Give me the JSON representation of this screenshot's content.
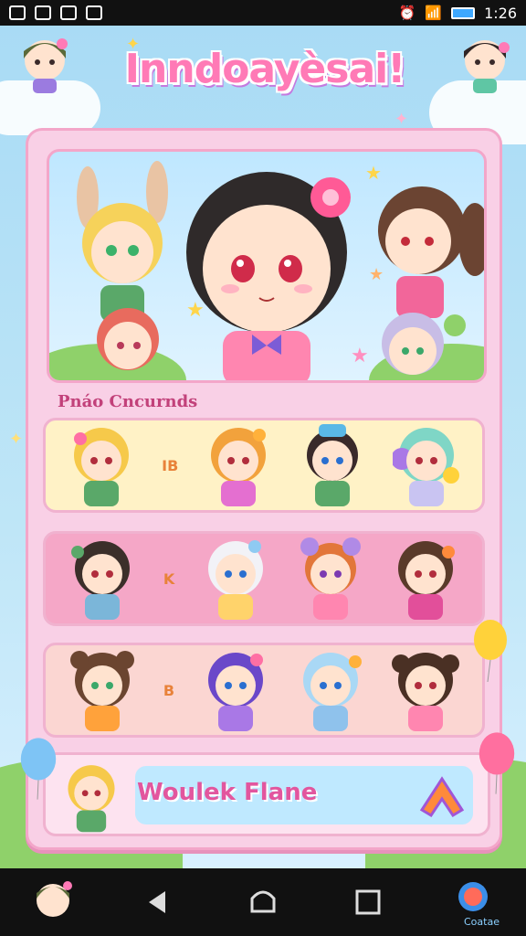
{
  "status_bar": {
    "time": "1:26"
  },
  "app": {
    "title": "Inndoayèsai!"
  },
  "section": {
    "title": "Pnáo Cncurnds"
  },
  "bottom_card": {
    "label": "Woulek Flane",
    "action_icon": "arrow-up-icon"
  },
  "nav": {
    "app_label": "Coatae"
  },
  "colors": {
    "accent": "#ff7ab6",
    "panel": "#f9d0e6",
    "row1": "#fff2c6",
    "row2": "#f5a7c7",
    "row3": "#fbd6d2"
  },
  "rows": [
    {
      "separator": "IB",
      "characters": [
        {
          "name": "blonde-girl",
          "hair": "#f6c94a"
        },
        {
          "name": "orange-hair-girl",
          "hair": "#f2a23c"
        },
        {
          "name": "hat-boy",
          "hair": "#3a2a2a"
        },
        {
          "name": "teal-hair-girl",
          "hair": "#7fd6c6"
        }
      ]
    },
    {
      "separator": "K",
      "characters": [
        {
          "name": "dark-hair-boy",
          "hair": "#3b2f2a"
        },
        {
          "name": "white-hair-girl",
          "hair": "#f2f2f7"
        },
        {
          "name": "orange-hair-girl",
          "hair": "#e2763a"
        },
        {
          "name": "brown-hair-girl",
          "hair": "#5a3a2a"
        }
      ]
    },
    {
      "separator": "B",
      "characters": [
        {
          "name": "brown-bun-girl",
          "hair": "#6b4530"
        },
        {
          "name": "purple-hair-girl",
          "hair": "#6a48c9"
        },
        {
          "name": "light-blue-hair-boy",
          "hair": "#a9d8f5"
        },
        {
          "name": "dark-bun-girl",
          "hair": "#4a3024"
        }
      ]
    }
  ]
}
